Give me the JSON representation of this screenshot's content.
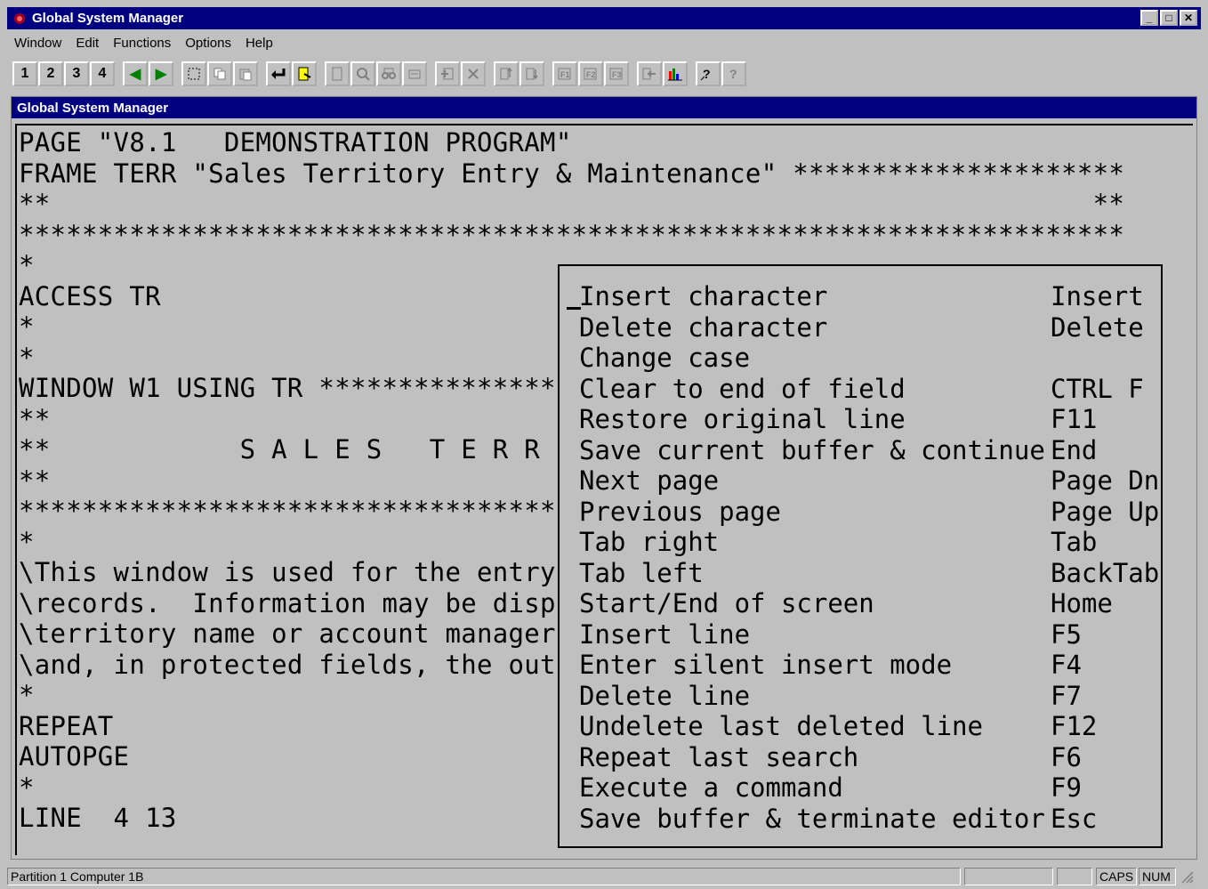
{
  "app": {
    "title": "Global System Manager",
    "controls": {
      "minimize": "_",
      "maximize": "□",
      "close": "✕"
    }
  },
  "menu": [
    "Window",
    "Edit",
    "Functions",
    "Options",
    "Help"
  ],
  "toolbar": {
    "numbers": [
      "1",
      "2",
      "3",
      "4"
    ],
    "nav": [
      "◀",
      "▶"
    ]
  },
  "child": {
    "title": "Global System Manager"
  },
  "terminal": {
    "lines": [
      "PAGE \"V8.1   DEMONSTRATION PROGRAM\"",
      "FRAME TERR \"Sales Territory Entry & Maintenance\" *********************",
      "**                                                                  **",
      "**********************************************************************",
      "*",
      "ACCESS TR",
      "*",
      "*",
      "WINDOW W1 USING TR ****************",
      "**",
      "**            S A L E S   T E R R I",
      "**",
      "**********************************",
      "*",
      "\\This window is used for the entry a",
      "\\records.  Information may be displa",
      "\\territory name or account manager.",
      "\\and, in protected fields, the outst",
      "*",
      "REPEAT",
      "AUTOPGE",
      "*",
      "LINE  4 13"
    ]
  },
  "help": {
    "rows": [
      {
        "action": "Insert character",
        "key": "Insert"
      },
      {
        "action": "Delete character",
        "key": "Delete"
      },
      {
        "action": "Change case",
        "key": ""
      },
      {
        "action": "Clear to end of field",
        "key": "CTRL F"
      },
      {
        "action": "Restore original line",
        "key": "F11"
      },
      {
        "action": "Save current buffer & continue",
        "key": "End"
      },
      {
        "action": "Next page",
        "key": "Page Dn"
      },
      {
        "action": "Previous page",
        "key": "Page Up"
      },
      {
        "action": "Tab right",
        "key": "Tab"
      },
      {
        "action": "Tab left",
        "key": "BackTab"
      },
      {
        "action": "Start/End of screen",
        "key": "Home"
      },
      {
        "action": "Insert line",
        "key": "F5"
      },
      {
        "action": "Enter silent insert mode",
        "key": "F4"
      },
      {
        "action": "Delete line",
        "key": "F7"
      },
      {
        "action": "Undelete last deleted line",
        "key": "F12"
      },
      {
        "action": "Repeat last search",
        "key": "F6"
      },
      {
        "action": "Execute a command",
        "key": "F9"
      },
      {
        "action": "Save buffer & terminate editor",
        "key": "Esc"
      }
    ]
  },
  "status": {
    "partition": "Partition 1 Computer 1B",
    "caps": "CAPS",
    "num": "NUM"
  }
}
